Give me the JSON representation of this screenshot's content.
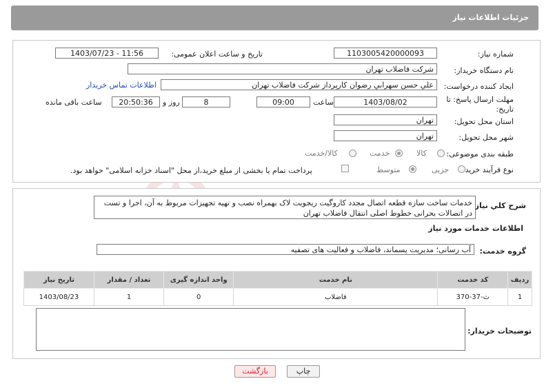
{
  "header": {
    "title": "جزئیات اطلاعات نیاز"
  },
  "form": {
    "need_number": {
      "label": "شماره نیاز:",
      "value": "1103005420000093"
    },
    "announce_datetime": {
      "label": "تاریخ و ساعت اعلان عمومی:",
      "value": "1403/07/23 - 11:56"
    },
    "buyer_org": {
      "label": "نام دستگاه خریدار:",
      "value": "شرکت فاضلاب تهران"
    },
    "requester": {
      "label": "ایجاد کننده درخواست:",
      "value": "علي حسن  سهرابي رضوان کارپرداز شرکت فاضلاب تهران"
    },
    "contact_link": "اطلاعات تماس خریدار",
    "deadline": {
      "label_line1": "مهلت ارسال پاسخ: تا",
      "label_line2": "تاریخ:",
      "date": "1403/08/02",
      "time_label": "ساعت",
      "time": "09:00",
      "days": "8",
      "days_label": "روز و",
      "remaining": "20:50:36",
      "remaining_label": "ساعت باقی مانده"
    },
    "province": {
      "label": "استان محل تحویل:",
      "value": "تهران"
    },
    "city": {
      "label": "شهر محل تحویل:",
      "value": "تهران"
    },
    "category": {
      "label": "طبقه بندی موضوعی:",
      "options": [
        "کالا",
        "خدمت",
        "کالا/خدمت"
      ],
      "selected": "خدمت"
    },
    "purchase_type": {
      "label": "نوع فرآیند خرید :",
      "options": [
        "جزیی",
        "متوسط"
      ],
      "selected": "متوسط",
      "treasury_text": "پرداخت تمام یا بخشی از مبلغ خرید،از محل \"اسناد خزانه اسلامی\" خواهد بود."
    }
  },
  "summary": {
    "label": "شرح کلي نياز:",
    "text": "خدمات ساخت سازه قطعه اتصال مجدد کاروگیت ریجویت لاک بهمراه نصب و تهیه تجهیزات مربوط به آن، اجرا و تست در اتصالات بحرانی خطوط اصلی انتقال فاضلاب تهران"
  },
  "services": {
    "heading": "اطلاعات خدمات مورد نیاز",
    "group_label": "گروه خدمت:",
    "group_value": "آب رسانی؛ مدیریت پسماند، فاضلاب و فعالیت های تصفیه",
    "columns": [
      "ردیف",
      "کد خدمت",
      "نام خدمت",
      "واحد اندازه گیری",
      "تعداد / مقدار",
      "تاریخ نیاز"
    ],
    "rows": [
      [
        "1",
        "ث-37-370",
        "فاضلاب",
        "0",
        "1",
        "1403/08/23"
      ]
    ]
  },
  "buyer_notes": {
    "label": "توضیحات خریدار:",
    "value": ""
  },
  "buttons": {
    "print": "چاپ",
    "back": "بازگشت"
  },
  "colors": {
    "header_bg": "#9a9a9a",
    "link": "#1a4fb8",
    "back_btn": "#fde7e7"
  }
}
